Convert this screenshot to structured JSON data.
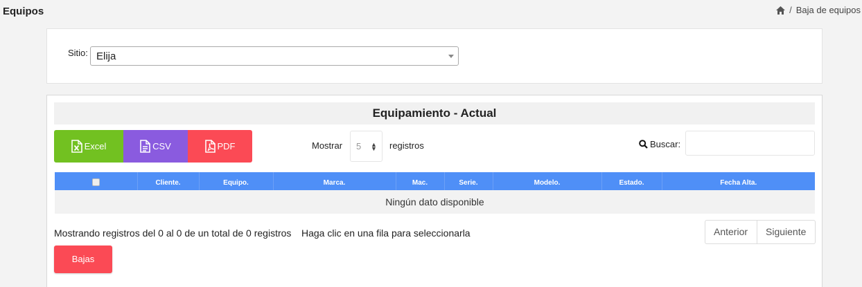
{
  "header": {
    "title": "Equipos",
    "breadcrumb": {
      "current": "Baja de equipos",
      "separator": "/"
    }
  },
  "site_filter": {
    "label": "Sitio:",
    "selected": "Elija"
  },
  "panel": {
    "title": "Equipamiento - Actual",
    "export": {
      "excel": "Excel",
      "csv": "CSV",
      "pdf": "PDF"
    },
    "length": {
      "prefix": "Mostrar",
      "value": "5",
      "suffix": "registros"
    },
    "search": {
      "label": "Buscar:",
      "value": ""
    },
    "table": {
      "columns": [
        "Cliente.",
        "Equipo.",
        "Marca.",
        "Mac.",
        "Serie.",
        "Modelo.",
        "Estado.",
        "Fecha Alta."
      ],
      "empty_message": "Ningún dato disponible"
    },
    "info": "Mostrando registros del 0 al 0 de un total de 0 registros",
    "hint": "Haga clic en una fila para seleccionarla",
    "pager": {
      "prev": "Anterior",
      "next": "Siguiente"
    },
    "bajas_button": "Bajas"
  },
  "colors": {
    "excel": "#72c121",
    "csv": "#8a5bdf",
    "pdf": "#fb4a55",
    "table_header": "#4f8ff7",
    "bajas": "#fb4a55"
  },
  "icons": {
    "home": "home-icon",
    "excel": "file-excel-icon",
    "csv": "file-text-icon",
    "pdf": "file-pdf-icon",
    "search": "search-icon"
  }
}
